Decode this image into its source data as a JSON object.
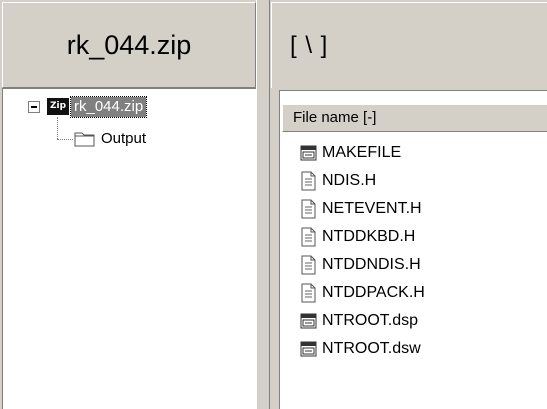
{
  "left_pane": {
    "title": "rk_044.zip",
    "tree": {
      "expander_icon": "minus-box-icon",
      "root": {
        "icon": "zip-icon",
        "icon_text": "Zip",
        "label": "rk_044.zip"
      },
      "children": [
        {
          "icon": "folder-icon",
          "label": "Output"
        }
      ]
    }
  },
  "right_pane": {
    "path": "[ \\ ]",
    "column_header": "File name [-]",
    "files": [
      {
        "name": "MAKEFILE",
        "icon": "project-file-icon"
      },
      {
        "name": "NDIS.H",
        "icon": "text-file-icon"
      },
      {
        "name": "NETEVENT.H",
        "icon": "text-file-icon"
      },
      {
        "name": "NTDDKBD.H",
        "icon": "text-file-icon"
      },
      {
        "name": "NTDDNDIS.H",
        "icon": "text-file-icon"
      },
      {
        "name": "NTDDPACK.H",
        "icon": "text-file-icon"
      },
      {
        "name": "NTROOT.dsp",
        "icon": "project-file-icon"
      },
      {
        "name": "NTROOT.dsw",
        "icon": "project-file-icon"
      }
    ]
  },
  "colors": {
    "panel_bg": "#d4d0c8",
    "list_bg": "#ffffff",
    "selection_bg": "#808080"
  }
}
